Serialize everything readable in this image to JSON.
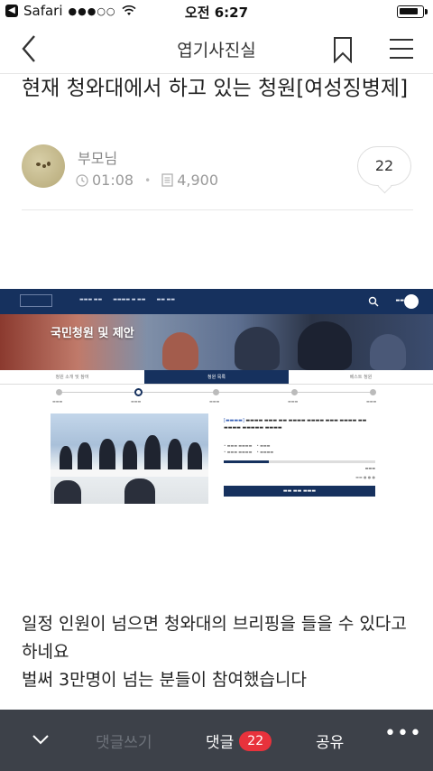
{
  "status_bar": {
    "back_app": "Safari",
    "signal": "●●●○○",
    "time": "오전 6:27",
    "battery_level": 0.85
  },
  "navbar": {
    "title": "엽기사진실"
  },
  "article": {
    "title": "현재 청와대에서 하고 있는 청원[여성징병제]",
    "author": "부모님",
    "time": "01:08",
    "views": "4,900",
    "comment_count": "22"
  },
  "embedded_screenshot": {
    "banner": "국민청원 및 제안",
    "tabs": [
      "청원 소개 및 참여",
      "청원 목록",
      "베스트 청원"
    ],
    "active_tab": 1,
    "steps": 5,
    "active_step": 1,
    "petition_fill": 0.3
  },
  "body": {
    "lines": [
      "일정 인원이 넘으면 청와대의 브리핑을 들을 수 있다고 하네요",
      "벌써 3만명이 넘는 분들이 참여했습니다"
    ]
  },
  "bottom_bar": {
    "write_comment": "댓글쓰기",
    "comments_label": "댓글",
    "comments_count": "22",
    "share": "공유",
    "more": "•••"
  }
}
